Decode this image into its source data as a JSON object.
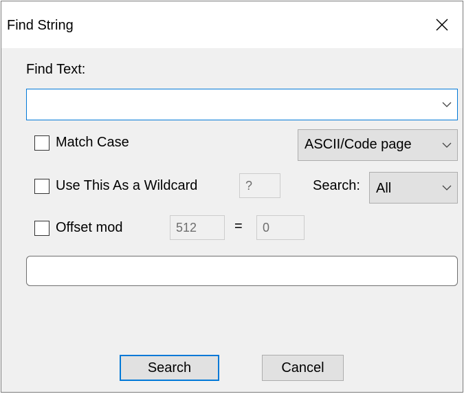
{
  "window": {
    "title": "Find String"
  },
  "find_text": {
    "label": "Find Text:",
    "value": ""
  },
  "options": {
    "match_case": {
      "label": "Match Case",
      "checked": false
    },
    "wildcard": {
      "label": "Use This As a Wildcard",
      "checked": false,
      "value": "?"
    },
    "offset_mod": {
      "label": "Offset mod",
      "checked": false,
      "mod_value": "512",
      "equals": "=",
      "result_value": "0"
    }
  },
  "encoding": {
    "selected": "ASCII/Code page"
  },
  "search_scope": {
    "label": "Search:",
    "selected": "All"
  },
  "status": {
    "text": ""
  },
  "buttons": {
    "search_label": "Search",
    "cancel_label": "Cancel"
  },
  "colors": {
    "focus_blue": "#0078d7",
    "dialog_bg": "#f0f0f0",
    "button_bg": "#e1e1e1"
  }
}
